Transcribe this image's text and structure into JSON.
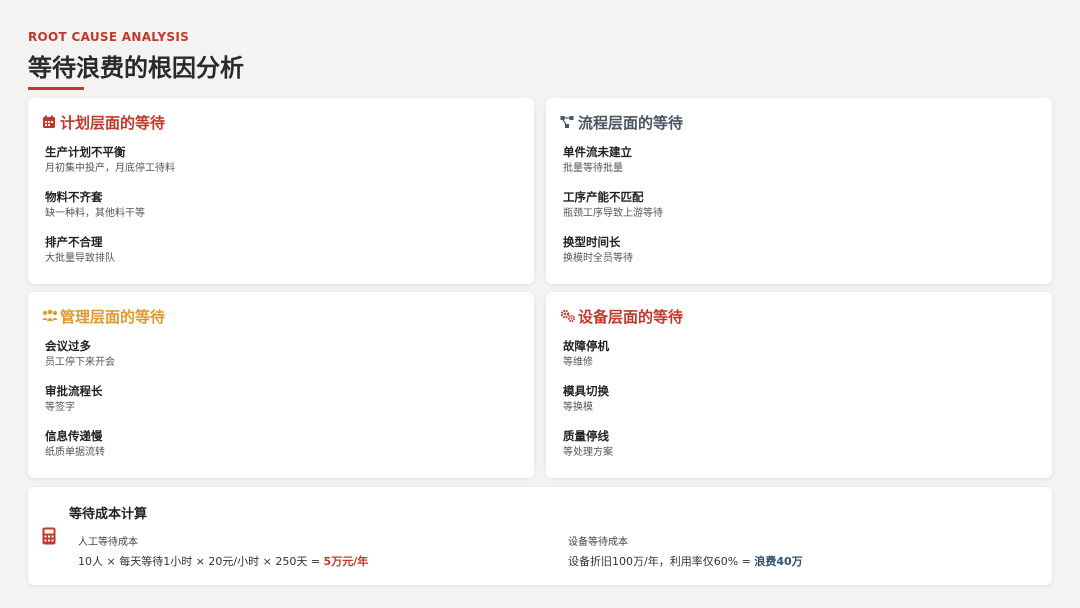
{
  "header": {
    "subtitle": "ROOT CAUSE ANALYSIS",
    "title": "等待浪费的根因分析"
  },
  "colors": {
    "accent_red": "#c0392b",
    "slate": "#4a5566",
    "amber": "#e09a2e",
    "navy": "#2f4f6f"
  },
  "cards": [
    {
      "title": "计划层面的等待",
      "icon": "calendar-icon",
      "items": [
        {
          "title": "生产计划不平衡",
          "desc": "月初集中投产，月底停工待料"
        },
        {
          "title": "物料不齐套",
          "desc": "缺一种料，其他料干等"
        },
        {
          "title": "排产不合理",
          "desc": "大批量导致排队"
        }
      ]
    },
    {
      "title": "流程层面的等待",
      "icon": "flow-icon",
      "items": [
        {
          "title": "单件流未建立",
          "desc": "批量等待批量"
        },
        {
          "title": "工序产能不匹配",
          "desc": "瓶颈工序导致上游等待"
        },
        {
          "title": "换型时间长",
          "desc": "换模时全员等待"
        }
      ]
    },
    {
      "title": "管理层面的等待",
      "icon": "people-icon",
      "items": [
        {
          "title": "会议过多",
          "desc": "员工停下来开会"
        },
        {
          "title": "审批流程长",
          "desc": "等签字"
        },
        {
          "title": "信息传递慢",
          "desc": "纸质单据流转"
        }
      ]
    },
    {
      "title": "设备层面的等待",
      "icon": "gears-icon",
      "items": [
        {
          "title": "故障停机",
          "desc": "等维修"
        },
        {
          "title": "模具切换",
          "desc": "等换模"
        },
        {
          "title": "质量停线",
          "desc": "等处理方案"
        }
      ]
    }
  ],
  "cost": {
    "title": "等待成本计算",
    "icon": "calculator-icon",
    "labor": {
      "label": "人工等待成本",
      "formula": "10人 × 每天等待1小时 × 20元/小时 × 250天 = ",
      "result": "5万元/年"
    },
    "equipment": {
      "label": "设备等待成本",
      "formula": "设备折旧100万/年，利用率仅60% = ",
      "result": "浪费40万"
    }
  }
}
